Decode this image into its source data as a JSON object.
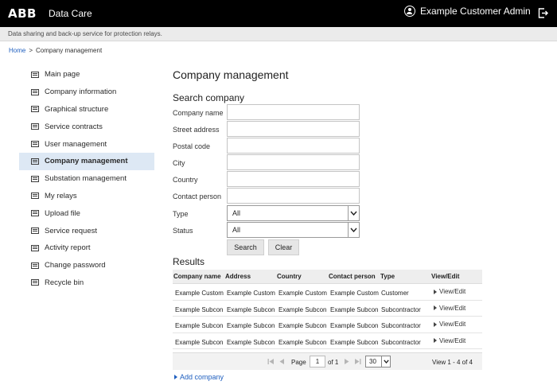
{
  "header": {
    "logo": "ABB",
    "app_name": "Data Care",
    "user_name": "Example Customer Admin",
    "tagline": "Data sharing and back-up service for protection relays."
  },
  "breadcrumb": {
    "home": "Home",
    "separator": ">",
    "current": "Company management"
  },
  "sidebar": {
    "items": [
      {
        "label": "Main page"
      },
      {
        "label": "Company information"
      },
      {
        "label": "Graphical structure"
      },
      {
        "label": "Service contracts"
      },
      {
        "label": "User management"
      },
      {
        "label": "Company management",
        "active": true
      },
      {
        "label": "Substation management"
      },
      {
        "label": "My relays"
      },
      {
        "label": "Upload file"
      },
      {
        "label": "Service request"
      },
      {
        "label": "Activity report"
      },
      {
        "label": "Change password"
      },
      {
        "label": "Recycle bin"
      }
    ]
  },
  "main": {
    "title": "Company management",
    "search_title": "Search company",
    "form": {
      "company_name": "Company name",
      "street_address": "Street address",
      "postal_code": "Postal code",
      "city": "City",
      "country": "Country",
      "contact_person": "Contact person",
      "type_label": "Type",
      "type_value": "All",
      "status_label": "Status",
      "status_value": "All"
    },
    "search_button": "Search",
    "clear_button": "Clear",
    "results_title": "Results"
  },
  "results": {
    "columns": [
      "Company name",
      "Address",
      "Country",
      "Contact person",
      "Type",
      "View/Edit"
    ],
    "rows": [
      {
        "company": "Example Custom",
        "address": "Example Custom",
        "country": "Example Custom",
        "contact": "Example Custom",
        "type": "Customer",
        "action": "View/Edit"
      },
      {
        "company": "Example Subcon",
        "address": "Example Subcon",
        "country": "Example Subcon",
        "contact": "Example Subcon",
        "type": "Subcontractor",
        "action": "View/Edit"
      },
      {
        "company": "Example Subcon",
        "address": "Example Subcon",
        "country": "Example Subcon",
        "contact": "Example Subcon",
        "type": "Subcontractor",
        "action": "View/Edit"
      },
      {
        "company": "Example Subcon",
        "address": "Example Subcon",
        "country": "Example Subcon",
        "contact": "Example Subcon",
        "type": "Subcontractor",
        "action": "View/Edit"
      }
    ],
    "pager": {
      "page_label": "Page",
      "page_value": "1",
      "of_label": "of 1",
      "per_page": "30",
      "range": "View 1 - 4 of 4"
    },
    "add_company": "Add company"
  },
  "colors": {
    "header_bg": "#000000",
    "link": "#1f5fbf",
    "active_bg": "#dde8f4"
  },
  "icons": [
    "user-icon",
    "logout-icon",
    "document-icon",
    "chevron-down-icon",
    "triangle-right-icon",
    "first-page-icon",
    "prev-page-icon",
    "next-page-icon",
    "last-page-icon"
  ]
}
